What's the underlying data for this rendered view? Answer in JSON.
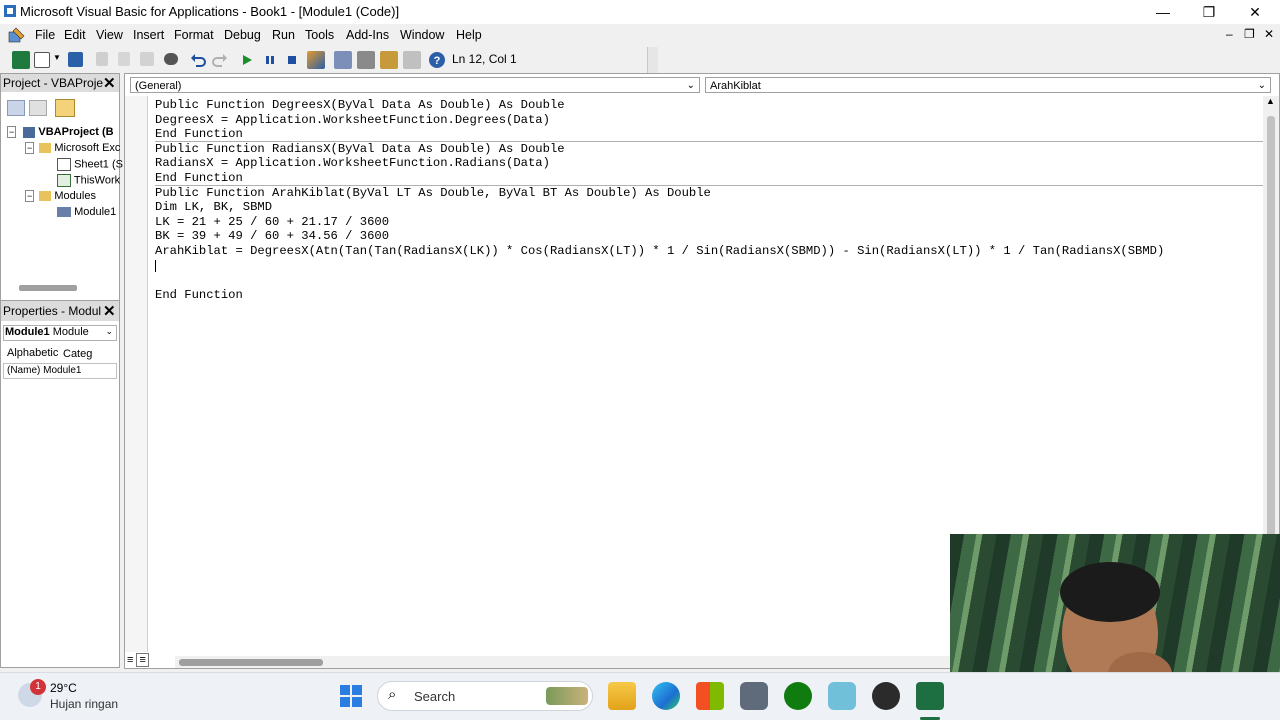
{
  "window": {
    "title": "Microsoft Visual Basic for Applications - Book1 - [Module1 (Code)]",
    "minimize": "—",
    "restore": "❐",
    "close": "✕"
  },
  "menu": {
    "items": [
      "File",
      "Edit",
      "View",
      "Insert",
      "Format",
      "Debug",
      "Run",
      "Tools",
      "Add-Ins",
      "Window",
      "Help"
    ],
    "mdi_min": "–",
    "mdi_restore": "❐",
    "mdi_close": "✕"
  },
  "toolbar": {
    "status": "Ln 12, Col 1",
    "icons": [
      "excel-icon",
      "insert-module-icon",
      "save-icon",
      "cut-icon",
      "copy-icon",
      "paste-icon",
      "find-icon",
      "undo-icon",
      "redo-icon",
      "run-icon",
      "break-icon",
      "reset-icon",
      "design-mode-icon",
      "project-explorer-icon",
      "properties-icon",
      "object-browser-icon",
      "toolbox-icon",
      "help-icon"
    ]
  },
  "project": {
    "title": "Project - VBAProje",
    "close": "✕",
    "tree": [
      {
        "label": "VBAProject (B",
        "level": 0,
        "bold": true
      },
      {
        "label": "Microsoft Exc",
        "level": 1,
        "bold": false
      },
      {
        "label": "Sheet1 (S",
        "level": 2,
        "bold": false
      },
      {
        "label": "ThisWork",
        "level": 2,
        "bold": false
      },
      {
        "label": "Modules",
        "level": 1,
        "bold": false
      },
      {
        "label": "Module1",
        "level": 2,
        "bold": false
      }
    ]
  },
  "properties": {
    "title": "Properties - Modul",
    "close": "✕",
    "object_name": "Module1",
    "object_type": "Module",
    "tabs": [
      "Alphabetic",
      "Categ"
    ],
    "rows": [
      {
        "name": "(Name)",
        "value": "Module1"
      }
    ]
  },
  "code": {
    "object_combo": "(General)",
    "proc_combo": "ArahKiblat",
    "lines": [
      "Public Function DegreesX(ByVal Data As Double) As Double",
      "DegreesX = Application.WorksheetFunction.Degrees(Data)",
      "End Function",
      "Public Function RadiansX(ByVal Data As Double) As Double",
      "RadiansX = Application.WorksheetFunction.Radians(Data)",
      "End Function",
      "Public Function ArahKiblat(ByVal LT As Double, ByVal BT As Double) As Double",
      "Dim LK, BK, SBMD",
      "LK = 21 + 25 / 60 + 21.17 / 3600",
      "BK = 39 + 49 / 60 + 34.56 / 3600",
      "ArahKiblat = DegreesX(Atn(Tan(Tan(RadiansX(LK)) * Cos(RadiansX(LT)) * 1 / Sin(RadiansX(SBMD)) - Sin(RadiansX(LT)) * 1 / Tan(RadiansX(SBMD)",
      "",
      "",
      "End Function"
    ]
  },
  "taskbar": {
    "weather_badge": "1",
    "temperature": "29°C",
    "weather_desc": "Hujan ringan",
    "search_placeholder": "Search",
    "apps": [
      "start-icon",
      "file-explorer-icon",
      "edge-icon",
      "store-icon",
      "camera-icon",
      "xbox-icon",
      "meet-icon",
      "obs-icon",
      "excel-icon"
    ]
  },
  "colors": {
    "title_bar": "#ffffff",
    "chrome": "#f0f0f0",
    "code_bg": "#ffffff",
    "separator": "#b0b0b0",
    "taskbar": "#eef1f5"
  }
}
